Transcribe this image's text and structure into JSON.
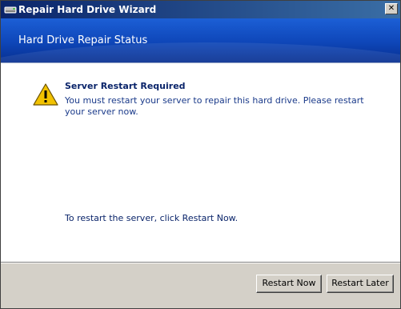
{
  "window": {
    "title": "Repair Hard Drive Wizard",
    "close_glyph": "✕",
    "title_icon": "hard-drive-icon"
  },
  "banner": {
    "title": "Hard Drive Repair Status"
  },
  "message": {
    "icon": "warning-icon",
    "title": "Server Restart Required",
    "body": "You must restart your server to repair this hard drive. Please restart your server now."
  },
  "instruction": "To restart the server, click Restart Now.",
  "buttons": {
    "restart_now": "Restart Now",
    "restart_later": "Restart Later"
  },
  "colors": {
    "title_bar": "#0a246a",
    "banner": "#0e46b8",
    "heading_text": "#0a246a",
    "warning": "#f2c200"
  }
}
